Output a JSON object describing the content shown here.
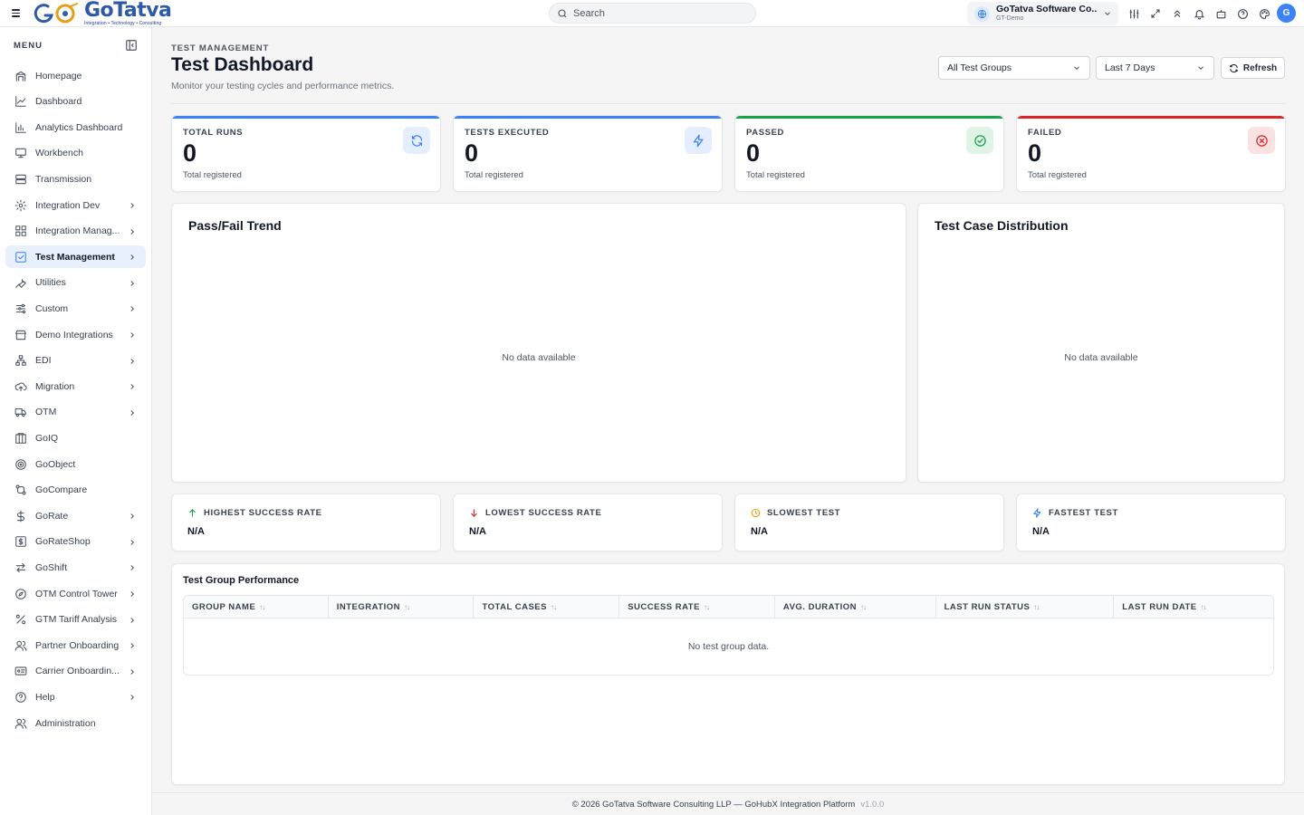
{
  "brand": {
    "name": "GoTatva",
    "tagline": "Integration • Technology • Consulting"
  },
  "search": {
    "placeholder": "Search"
  },
  "org": {
    "name": "GoTatva Software Co...",
    "sub": "GT-Demo"
  },
  "user": {
    "initial": "G"
  },
  "sidebar": {
    "menu_label": "MENU",
    "items": [
      {
        "label": "Homepage",
        "icon": "home-icon",
        "chevron": false
      },
      {
        "label": "Dashboard",
        "icon": "line-chart-icon",
        "chevron": false
      },
      {
        "label": "Analytics Dashboard",
        "icon": "bar-chart-icon",
        "chevron": false
      },
      {
        "label": "Workbench",
        "icon": "monitor-icon",
        "chevron": false
      },
      {
        "label": "Transmission",
        "icon": "server-icon",
        "chevron": false
      },
      {
        "label": "Integration Dev",
        "icon": "gear-icon",
        "chevron": true
      },
      {
        "label": "Integration Manag...",
        "icon": "grid-icon",
        "chevron": true
      },
      {
        "label": "Test Management",
        "icon": "checkbox-icon",
        "chevron": true,
        "active": true
      },
      {
        "label": "Utilities",
        "icon": "wrench-icon",
        "chevron": true
      },
      {
        "label": "Custom",
        "icon": "sliders-icon",
        "chevron": true
      },
      {
        "label": "Demo Integrations",
        "icon": "store-icon",
        "chevron": true
      },
      {
        "label": "EDI",
        "icon": "network-icon",
        "chevron": true
      },
      {
        "label": "Migration",
        "icon": "cloud-upload-icon",
        "chevron": true
      },
      {
        "label": "OTM",
        "icon": "truck-icon",
        "chevron": true
      },
      {
        "label": "GoIQ",
        "icon": "columns-icon",
        "chevron": false
      },
      {
        "label": "GoObject",
        "icon": "target-icon",
        "chevron": false
      },
      {
        "label": "GoCompare",
        "icon": "compare-icon",
        "chevron": false
      },
      {
        "label": "GoRate",
        "icon": "dollar-icon",
        "chevron": true
      },
      {
        "label": "GoRateShop",
        "icon": "dollar-box-icon",
        "chevron": true
      },
      {
        "label": "GoShift",
        "icon": "swap-icon",
        "chevron": true
      },
      {
        "label": "OTM Control Tower",
        "icon": "compass-icon",
        "chevron": true
      },
      {
        "label": "GTM Tariff Analysis",
        "icon": "percent-icon",
        "chevron": true
      },
      {
        "label": "Partner Onboarding",
        "icon": "users-icon",
        "chevron": true
      },
      {
        "label": "Carrier Onboardin...",
        "icon": "id-card-icon",
        "chevron": true
      },
      {
        "label": "Help",
        "icon": "help-circle-icon",
        "chevron": true
      },
      {
        "label": "Administration",
        "icon": "admin-users-icon",
        "chevron": false
      }
    ]
  },
  "header": {
    "eyebrow": "TEST MANAGEMENT",
    "title": "Test Dashboard",
    "subtitle": "Monitor your testing cycles and performance metrics.",
    "group_select": "All Test Groups",
    "range_select": "Last 7 Days",
    "refresh_label": "Refresh"
  },
  "stats": [
    {
      "label": "TOTAL RUNS",
      "value": "0",
      "sub": "Total registered",
      "color": "#3b82f6",
      "icon": "refresh-icon"
    },
    {
      "label": "TESTS EXECUTED",
      "value": "0",
      "sub": "Total registered",
      "color": "#3b82f6",
      "icon": "lightning-icon"
    },
    {
      "label": "PASSED",
      "value": "0",
      "sub": "Total registered",
      "color": "#16a34a",
      "icon": "check-circle-icon"
    },
    {
      "label": "FAILED",
      "value": "0",
      "sub": "Total registered",
      "color": "#dc2626",
      "icon": "x-circle-icon"
    }
  ],
  "trend_panel": {
    "title": "Pass/Fail Trend",
    "empty": "No data available"
  },
  "distribution_panel": {
    "title": "Test Case Distribution",
    "empty": "No data available"
  },
  "metrics": [
    {
      "label": "HIGHEST SUCCESS RATE",
      "value": "N/A",
      "icon": "arrow-up-icon",
      "color": "#16a34a"
    },
    {
      "label": "LOWEST SUCCESS RATE",
      "value": "N/A",
      "icon": "arrow-down-icon",
      "color": "#dc2626"
    },
    {
      "label": "SLOWEST TEST",
      "value": "N/A",
      "icon": "clock-icon",
      "color": "#f59e0b"
    },
    {
      "label": "FASTEST TEST",
      "value": "N/A",
      "icon": "lightning-icon",
      "color": "#3b82f6"
    }
  ],
  "group_table": {
    "title": "Test Group Performance",
    "columns": [
      "GROUP NAME",
      "INTEGRATION",
      "TOTAL CASES",
      "SUCCESS RATE",
      "AVG. DURATION",
      "LAST RUN STATUS",
      "LAST RUN DATE"
    ],
    "empty": "No test group data."
  },
  "footer": {
    "text": "© 2026 GoTatva Software Consulting LLP — GoHubX Integration Platform",
    "version": "v1.0.0"
  }
}
